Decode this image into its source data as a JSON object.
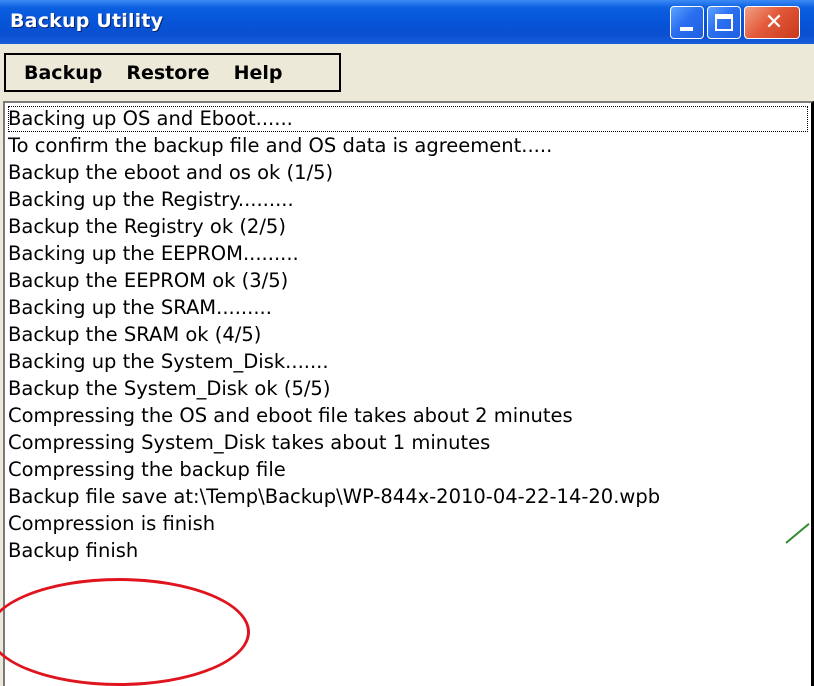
{
  "window": {
    "title": "Backup Utility",
    "minimize_glyph": "minimize-icon",
    "maximize_glyph": "maximize-icon",
    "close_glyph": "✕",
    "titlebar_color": "#0753d8",
    "close_color": "#e3593a"
  },
  "menubar": {
    "items": [
      {
        "label": "Backup"
      },
      {
        "label": "Restore"
      },
      {
        "label": "Help"
      }
    ]
  },
  "log": {
    "lines": [
      "Backing up OS and Eboot......",
      "To confirm the backup file and OS data is agreement.....",
      "Backup the eboot and os ok (1/5)",
      "Backing up the Registry.........",
      "Backup the Registry ok (2/5)",
      "Backing up the EEPROM.........",
      "Backup the EEPROM ok (3/5)",
      "Backing up the SRAM.........",
      "Backup the SRAM ok (4/5)",
      "Backing up the System_Disk.......",
      "Backup the System_Disk ok (5/5)",
      "Compressing the OS and eboot file takes about 2 minutes",
      "Compressing System_Disk takes about 1 minutes",
      "Compressing the backup file",
      "Backup file save at:\\Temp\\Backup\\WP-844x-2010-04-22-14-20.wpb",
      "Compression is finish",
      "Backup finish"
    ]
  },
  "annotation": {
    "highlight_color": "#e0141e",
    "callout_color": "#2e8b2e"
  }
}
